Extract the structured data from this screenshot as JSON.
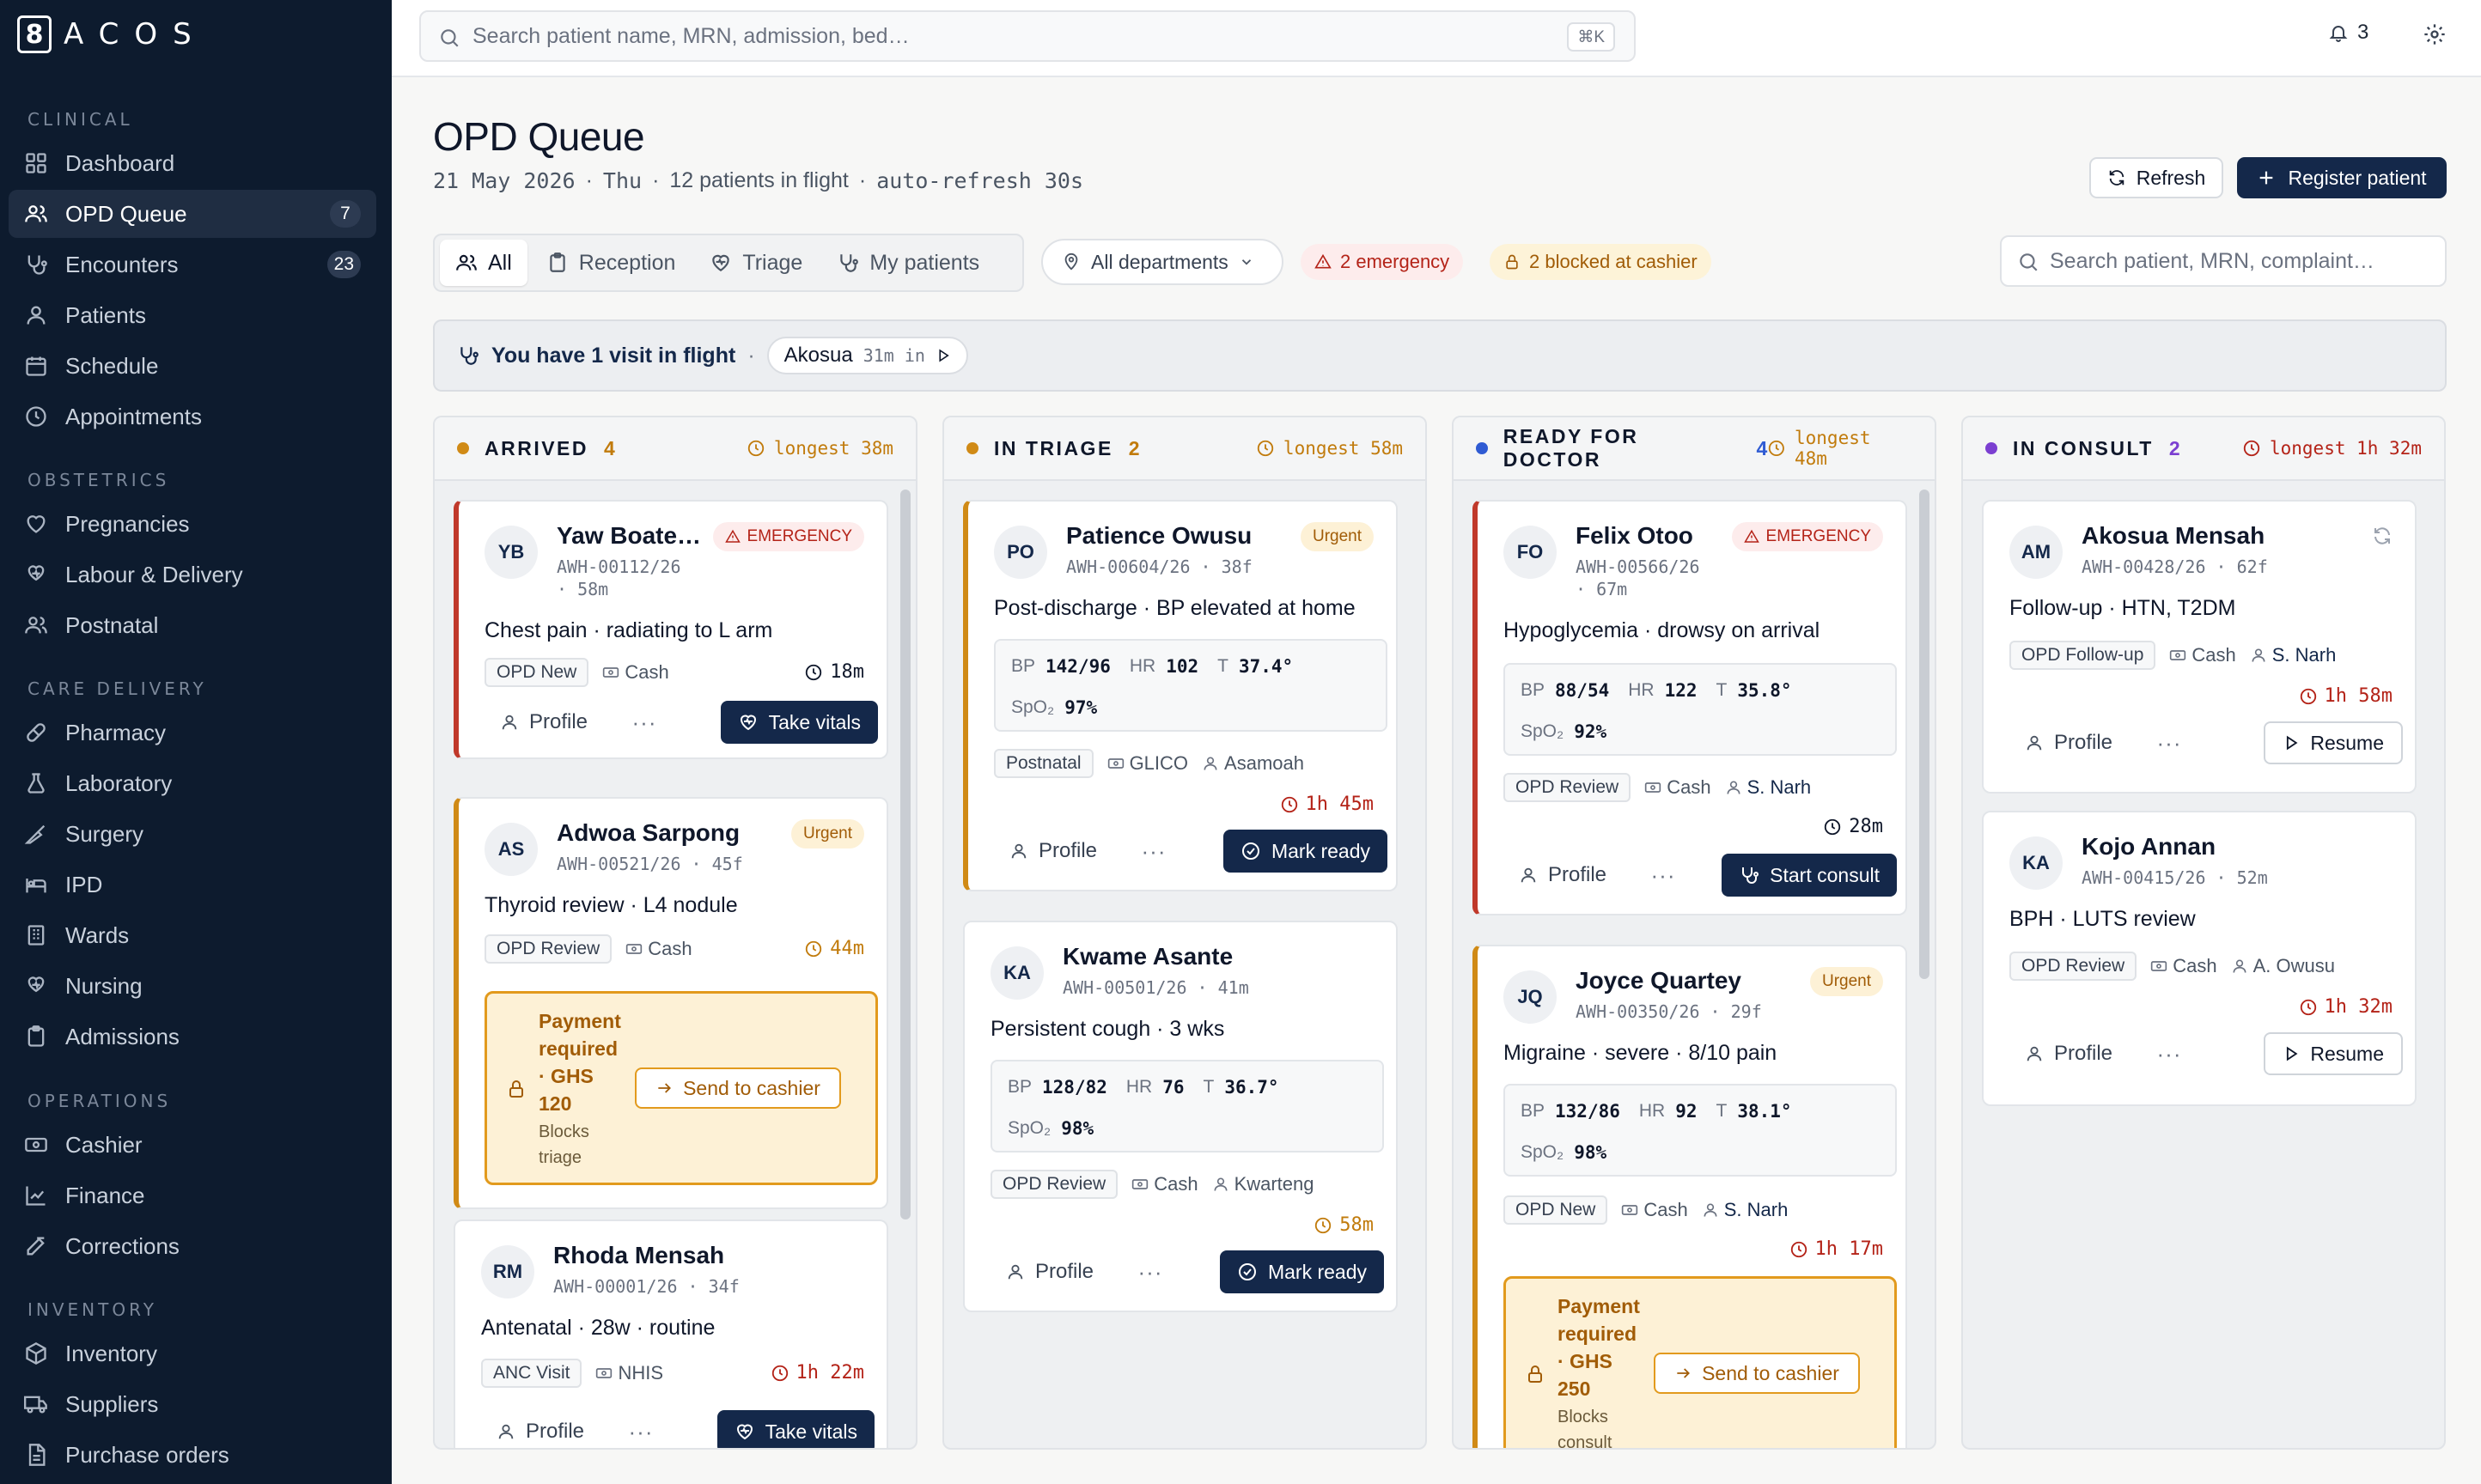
{
  "brand": {
    "logo_glyph": "8",
    "wordmark": "ACOS"
  },
  "sidebar": {
    "sections": [
      {
        "label": "CLINICAL",
        "items": [
          {
            "label": "Dashboard",
            "icon": "grid-icon"
          },
          {
            "label": "OPD Queue",
            "icon": "users-icon",
            "badge": "7",
            "active": true
          },
          {
            "label": "Encounters",
            "icon": "stethoscope-icon",
            "badge": "23"
          },
          {
            "label": "Patients",
            "icon": "user-icon"
          },
          {
            "label": "Schedule",
            "icon": "calendar-icon"
          },
          {
            "label": "Appointments",
            "icon": "clock-icon"
          }
        ]
      },
      {
        "label": "OBSTETRICS",
        "items": [
          {
            "label": "Pregnancies",
            "icon": "heart-icon"
          },
          {
            "label": "Labour & Delivery",
            "icon": "heart-hand-icon"
          },
          {
            "label": "Postnatal",
            "icon": "users-icon"
          }
        ]
      },
      {
        "label": "CARE DELIVERY",
        "items": [
          {
            "label": "Pharmacy",
            "icon": "pill-icon"
          },
          {
            "label": "Laboratory",
            "icon": "flask-icon"
          },
          {
            "label": "Surgery",
            "icon": "scalpel-icon"
          },
          {
            "label": "IPD",
            "icon": "bed-icon"
          },
          {
            "label": "Wards",
            "icon": "building-icon"
          },
          {
            "label": "Nursing",
            "icon": "heart-hand-icon"
          },
          {
            "label": "Admissions",
            "icon": "clipboard-icon"
          }
        ]
      },
      {
        "label": "OPERATIONS",
        "items": [
          {
            "label": "Cashier",
            "icon": "cash-icon"
          },
          {
            "label": "Finance",
            "icon": "chart-line-icon"
          },
          {
            "label": "Corrections",
            "icon": "edit-icon"
          }
        ]
      },
      {
        "label": "INVENTORY",
        "items": [
          {
            "label": "Inventory",
            "icon": "box-icon"
          },
          {
            "label": "Suppliers",
            "icon": "truck-icon"
          },
          {
            "label": "Purchase orders",
            "icon": "document-icon"
          }
        ]
      }
    ]
  },
  "topbar": {
    "search_placeholder": "Search patient name, MRN, admission, bed…",
    "shortcut": "⌘K",
    "notification_count": "3"
  },
  "header": {
    "title": "OPD Queue",
    "date": "21 May 2026",
    "weekday": "Thu",
    "patients_in_flight": "12 patients in flight",
    "refresh_note": "auto-refresh 30s",
    "sep": "·",
    "refresh_label": "Refresh",
    "register_label": "Register patient"
  },
  "filters": {
    "tabs": [
      {
        "label": "All",
        "icon": "users-icon",
        "active": true
      },
      {
        "label": "Reception",
        "icon": "clipboard-icon"
      },
      {
        "label": "Triage",
        "icon": "heart-icon"
      },
      {
        "label": "My patients",
        "icon": "stethoscope-icon"
      }
    ],
    "department": "All departments",
    "emergency_pill": "2 emergency",
    "blocked_pill": "2 blocked at cashier",
    "search_placeholder": "Search patient, MRN, complaint…"
  },
  "banner": {
    "text": "You have 1 visit in flight",
    "sep": "·",
    "patient": "Akosua",
    "elapsed": "31m in"
  },
  "columns": [
    {
      "name": "ARRIVED",
      "count": "4",
      "longest": "longest 38m",
      "dot_color": "#d08a16",
      "count_color": "#c17b0c",
      "longest_color": "#c17b0c"
    },
    {
      "name": "IN TRIAGE",
      "count": "2",
      "longest": "longest 58m",
      "dot_color": "#d08a16",
      "count_color": "#c17b0c",
      "longest_color": "#c17b0c"
    },
    {
      "name": "READY FOR DOCTOR",
      "count": "4",
      "longest": "longest 48m",
      "dot_color": "#2f5bd3",
      "count_color": "#2f5bd3",
      "longest_color": "#c17b0c"
    },
    {
      "name": "IN CONSULT",
      "count": "2",
      "longest": "longest 1h 32m",
      "dot_color": "#7b3fd1",
      "count_color": "#7b3fd1",
      "longest_color": "#b42318"
    }
  ],
  "cards": {
    "c1": {
      "initials": "YB",
      "name": "Yaw Boate…",
      "mrn": "AWH-00112/26",
      "age": "· 58m",
      "badge": "EMERGENCY",
      "complaint": "Chest pain · radiating to L arm",
      "tag": "OPD New",
      "payer": "Cash",
      "wait": "18m",
      "profile": "Profile",
      "more": "···",
      "action": "Take vitals"
    },
    "c2": {
      "initials": "AS",
      "name": "Adwoa Sarpong",
      "mrn": "AWH-00521/26 · 45f",
      "badge": "Urgent",
      "complaint": "Thyroid review · L4 nodule",
      "tag": "OPD Review",
      "payer": "Cash",
      "wait": "44m",
      "pay_title": "Payment required · GHS 120",
      "pay_sub": "Blocks triage",
      "pay_btn": "Send to cashier"
    },
    "c3": {
      "initials": "RM",
      "name": "Rhoda Mensah",
      "mrn": "AWH-00001/26 · 34f",
      "complaint": "Antenatal · 28w · routine",
      "tag": "ANC Visit",
      "payer": "NHIS",
      "wait": "1h 22m",
      "profile": "Profile",
      "more": "···",
      "action": "Take vitals"
    },
    "c4": {
      "initials": "PO",
      "name": "Patience Owusu",
      "mrn": "AWH-00604/26 · 38f",
      "badge": "Urgent",
      "complaint": "Post-discharge · BP elevated at home",
      "bp": "142/96",
      "hr": "102",
      "t": "37.4°",
      "spo2": "97%",
      "tag": "Postnatal",
      "payer": "GLICO",
      "doctor": "Asamoah",
      "wait": "1h 45m",
      "profile": "Profile",
      "more": "···",
      "action": "Mark ready"
    },
    "c5": {
      "initials": "KA",
      "name": "Kwame Asante",
      "mrn": "AWH-00501/26 · 41m",
      "complaint": "Persistent cough · 3 wks",
      "bp": "128/82",
      "hr": "76",
      "t": "36.7°",
      "spo2": "98%",
      "tag": "OPD Review",
      "payer": "Cash",
      "doctor": "Kwarteng",
      "wait": "58m",
      "profile": "Profile",
      "more": "···",
      "action": "Mark ready"
    },
    "c6": {
      "initials": "FO",
      "name": "Felix Otoo",
      "mrn": "AWH-00566/26",
      "age": "· 67m",
      "badge": "EMERGENCY",
      "complaint": "Hypoglycemia · drowsy on arrival",
      "bp": "88/54",
      "hr": "122",
      "t": "35.8°",
      "spo2": "92%",
      "tag": "OPD Review",
      "payer": "Cash",
      "doctor": "S. Narh",
      "wait": "28m",
      "profile": "Profile",
      "more": "···",
      "action": "Start consult"
    },
    "c7": {
      "initials": "JQ",
      "name": "Joyce Quartey",
      "mrn": "AWH-00350/26 · 29f",
      "badge": "Urgent",
      "complaint": "Migraine · severe · 8/10 pain",
      "bp": "132/86",
      "hr": "92",
      "t": "38.1°",
      "spo2": "98%",
      "tag": "OPD New",
      "payer": "Cash",
      "doctor": "S. Narh",
      "wait": "1h 17m",
      "pay_title": "Payment required · GHS 250",
      "pay_sub": "Blocks consult",
      "pay_btn": "Send to cashier"
    },
    "c8": {
      "initials": "AM",
      "name": "Akosua Mensah",
      "mrn": "AWH-00428/26 · 62f",
      "complaint": "Follow-up · HTN, T2DM",
      "tag": "OPD Follow-up",
      "payer": "Cash",
      "doctor": "S. Narh",
      "wait": "1h 58m",
      "profile": "Profile",
      "more": "···",
      "action": "Resume"
    },
    "c9": {
      "initials": "KA",
      "name": "Kojo Annan",
      "mrn": "AWH-00415/26 · 52m",
      "complaint": "BPH · LUTS review",
      "tag": "OPD Review",
      "payer": "Cash",
      "doctor": "A. Owusu",
      "wait": "1h 32m",
      "profile": "Profile",
      "more": "···",
      "action": "Resume"
    }
  },
  "vital_labels": {
    "bp": "BP",
    "hr": "HR",
    "t": "T",
    "spo2": "SpO₂"
  },
  "colors": {
    "sidebar_bg": "#0d1b2e",
    "primary": "#14284a",
    "emergency": "#b42318",
    "urgent": "#a15c07"
  }
}
